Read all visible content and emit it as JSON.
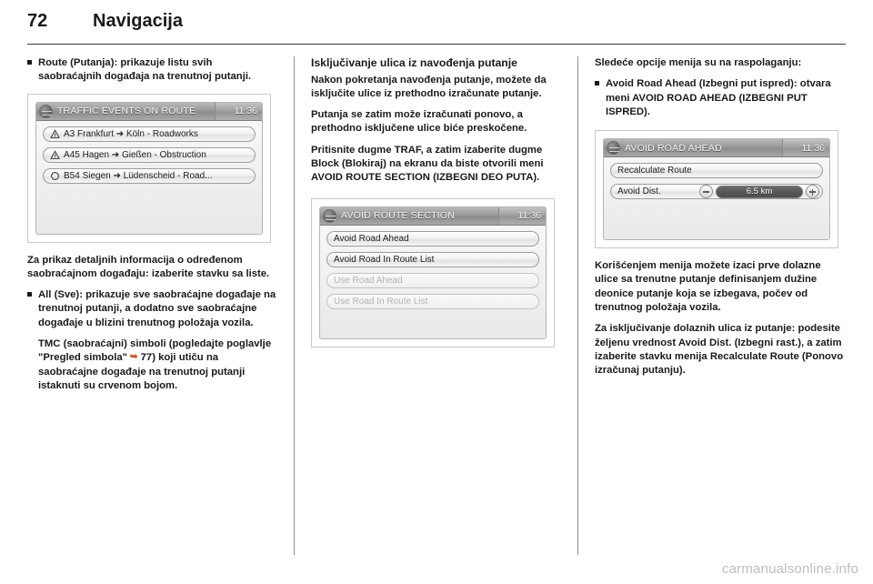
{
  "header": {
    "page_number": "72",
    "title": "Navigacija"
  },
  "left_column": {
    "bullet_route": {
      "term": "Route (Putanja)",
      "text": ": prikazuje listu svih saobraćajnih događaja na trenutnoj putanji."
    },
    "caption_after_shot": "Za prikaz detaljnih informacija o određenom saobraćajnom događaju: izaberite stavku sa liste.",
    "bullet_all": {
      "term": "All (Sve)",
      "text": ": prikazuje sve saobraćajne događaje na trenutnoj putanji, a dodatno sve saobraćajne događaje u blizini trenutnog položaja vozila."
    },
    "tmc_paragraph_1": "TMC (saobraćajni) simboli (pogledajte poglavlje \"Pregled simbola\"",
    "tmc_pageref": "77",
    "tmc_paragraph_2": ") koji utiču na saobraćajne događaje na trenutnoj putanji istaknuti su crvenom bojom."
  },
  "middle_column": {
    "heading": "Isključivanje ulica iz navođenja putanje",
    "paragraph_1": "Nakon pokretanja navođenja putanje, možete da isključite ulice iz prethodno izračunate putanje.",
    "paragraph_2": "Putanja se zatim može izračunati ponovo, a prethodno isključene ulice biće preskočene.",
    "paragraph_3": "Pritisnite dugme TRAF, a zatim izaberite dugme Block (Blokiraj) na ekranu da biste otvorili meni AVOID ROUTE SECTION (IZBEGNI DEO PUTA)."
  },
  "right_column": {
    "paragraph_1": "Sledeće opcije menija su na raspolaganju:",
    "bullet_avoid": {
      "term": "Avoid Road Ahead (Izbegni put ispred)",
      "text": ": otvara meni AVOID ROAD AHEAD (IZBEGNI PUT ISPRED)."
    },
    "paragraph_2": "Korišćenjem menija možete izaci prve dolazne ulice sa trenutne putanje definisanjem dužine deonice putanje koja se izbegava, počev od trenutnog položaja vozila.",
    "paragraph_3_pre": "Za isključivanje dolaznih ulica iz putanje: podesite željenu vrednost ",
    "paragraph_3_term1": "Avoid Dist. (Izbegni rast.)",
    "paragraph_3_mid": ", a zatim izaberite stavku menija ",
    "paragraph_3_term2": "Recalculate Route (Ponovo izračunaj putanju)",
    "paragraph_3_end": "."
  },
  "screens": {
    "traffic_events": {
      "title": "TRAFFIC EVENTS ON ROUTE",
      "clock": "11:36",
      "items": [
        {
          "icon": "warning-triangle-icon",
          "text": "A3 Frankfurt ➔ Köln - Roadworks",
          "disabled": false
        },
        {
          "icon": "warning-triangle-icon",
          "text": "A45 Hagen ➔ Gießen - Obstruction",
          "disabled": false
        },
        {
          "icon": "circle-icon",
          "text": "B54 Siegen ➔ Lüdenscheid - Road...",
          "disabled": false
        }
      ]
    },
    "avoid_route_section": {
      "title": "AVOID ROUTE SECTION",
      "clock": "11:36",
      "items": [
        {
          "text": "Avoid Road Ahead",
          "disabled": false
        },
        {
          "text": "Avoid Road In Route List",
          "disabled": false
        },
        {
          "text": "Use Road Ahead",
          "disabled": true
        },
        {
          "text": "Use Road In Route List",
          "disabled": true
        }
      ]
    },
    "avoid_road_ahead": {
      "title": "AVOID ROAD AHEAD",
      "clock": "11:36",
      "recalculate_label": "Recalculate Route",
      "avoid_dist_label": "Avoid Dist.",
      "avoid_dist_value": "6.5 km",
      "minus_label": "−",
      "plus_label": "+"
    }
  },
  "watermark": "carmanualsonline.info",
  "colors": {
    "text": "#1a1a1a",
    "pageref_accent": "#d8500f",
    "rule": "#3a3a3a",
    "watermark": "#bdbdbd"
  }
}
